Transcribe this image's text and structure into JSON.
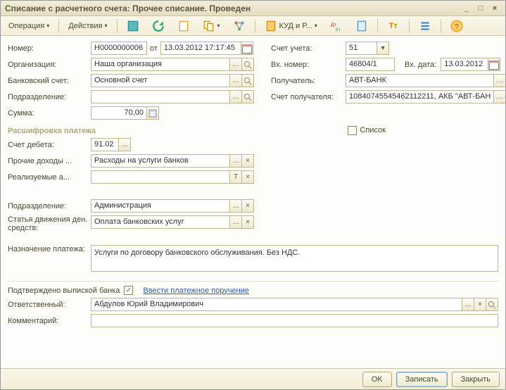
{
  "titlebar": {
    "title": "Списание с расчетного счета: Прочее списание. Проведен"
  },
  "toolbar": {
    "operation": "Операция",
    "actions": "Действия",
    "kud": "КУД и Р..."
  },
  "left": {
    "nomer_label": "Номер:",
    "nomer_value": "Н0000000006",
    "ot_label": "от",
    "date_value": "13.03.2012 17:17:45",
    "org_label": "Организация:",
    "org_value": "Наша организация",
    "bank_label": "Банковский счет:",
    "bank_value": "Основной счет",
    "podr_label": "Подразделение:",
    "podr_value": "",
    "summa_label": "Сумма:",
    "summa_value": "70,00"
  },
  "right_col": {
    "schet_label": "Счет учета:",
    "schet_value": "51",
    "vhnomer_label": "Вх. номер:",
    "vhnomer_value": "46804/1",
    "vhdata_label": "Вх. дата:",
    "vhdata_value": "13.03.2012",
    "poluch_label": "Получатель:",
    "poluch_value": "АВТ-БАНК",
    "schetpol_label": "Счет получателя:",
    "schetpol_value": "10840745545462112211, АКБ \"АВТ-БАН"
  },
  "rasch": {
    "title": "Расшифровка платежа",
    "spisok": "Список",
    "schetdeb_label": "Счет дебета:",
    "schetdeb_value": "91.02",
    "prochie_label": "Прочие доходы ...",
    "prochie_value": "Расходы на услуги банков",
    "realiz_label": "Реализуемые а...",
    "realiz_value": "",
    "podr_label": "Подразделение:",
    "podr_value": "Администрация",
    "statya_label": "Статья движения ден. средств:",
    "statya_value": "Оплата банковских услуг"
  },
  "nazn": {
    "label": "Назначение платежа:",
    "value": "Услуги по договору банковского обслуживания. Без НДС."
  },
  "bottom": {
    "confirmed_label": "Подтверждено выпиской банка",
    "link": "Ввести платежное поручение",
    "otv_label": "Ответственный:",
    "otv_value": "Абдулов Юрий Владимирович",
    "comment_label": "Комментарий:",
    "comment_value": ""
  },
  "footer": {
    "ok": "OK",
    "save": "Записать",
    "close": "Закрыть"
  }
}
